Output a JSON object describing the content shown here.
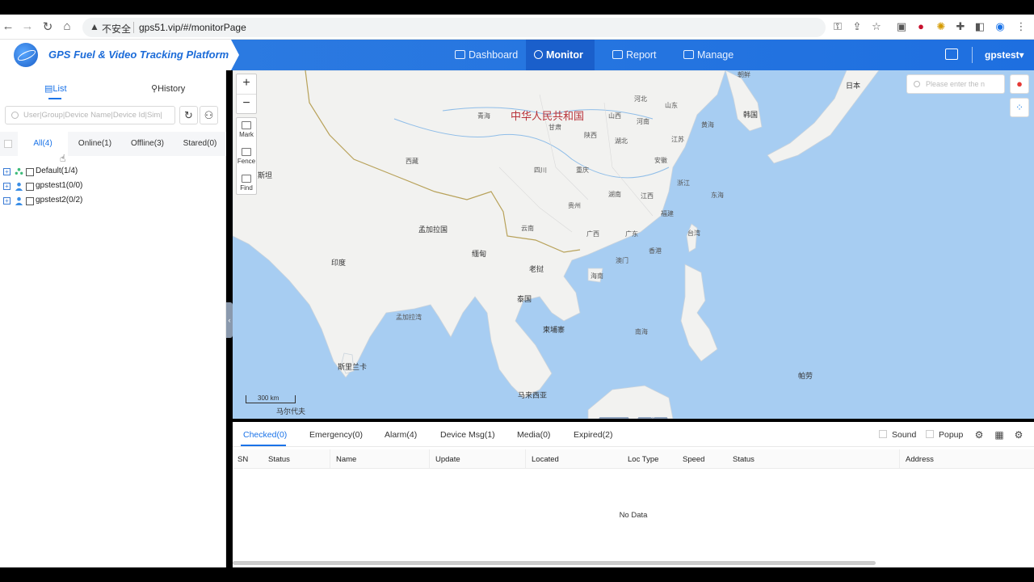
{
  "browser": {
    "insecure_label": "不安全",
    "url": "gps51.vip/#/monitorPage"
  },
  "app": {
    "title": "GPS Fuel & Video Tracking Platform",
    "menu": [
      {
        "label": "Dashboard",
        "active": false
      },
      {
        "label": "Monitor",
        "active": true
      },
      {
        "label": "Report",
        "active": false
      },
      {
        "label": "Manage",
        "active": false
      }
    ],
    "user": "gpstest▾"
  },
  "left": {
    "tabs": {
      "list": "List",
      "history": "History"
    },
    "search_placeholder": "User|Group|Device Name|Device Id|Sim|",
    "filters": [
      "All(4)",
      "Online(1)",
      "Offline(3)",
      "Stared(0)"
    ],
    "tree": [
      {
        "label": "Default(1/4)",
        "icon": "group-icon"
      },
      {
        "label": "gpstest1(0/0)",
        "icon": "user-icon"
      },
      {
        "label": "gpstest2(0/2)",
        "icon": "user-icon"
      }
    ]
  },
  "map": {
    "search_placeholder": "Please enter the n",
    "tools": {
      "mark": "Mark",
      "fence": "Fence",
      "find": "Find"
    },
    "scale": "300 km",
    "labels": {
      "china": "中华人民共和国",
      "japan": "日本",
      "korea": "韩国",
      "india": "印度",
      "bangladesh": "孟加拉国",
      "myanmar": "缅甸",
      "laos": "老挝",
      "thailand": "泰国",
      "cambodia": "柬埔寨",
      "srilanka": "斯里兰卡",
      "malaysia": "马来西亚",
      "maldives": "马尔代夫",
      "palau": "帕劳",
      "pakistan": "斯坦",
      "bay_bengal": "孟加拉湾",
      "south_sea": "南海",
      "east_sea": "东海",
      "yellow_sea": "黄海",
      "tibet": "西藏",
      "qinghai": "青海",
      "gansu": "甘肃",
      "sichuan": "四川",
      "yunnan": "云南",
      "guizhou": "贵州",
      "guangxi": "广西",
      "guangdong": "广东",
      "hainan": "海南",
      "hunan": "湖南",
      "hubei": "湖北",
      "jiangxi": "江西",
      "fujian": "福建",
      "zhejiang": "浙江",
      "anhui": "安徽",
      "jiangsu": "江苏",
      "henan": "河南",
      "shandong": "山东",
      "shanxi": "山西",
      "shaanxi": "陕西",
      "chongqing": "重庆",
      "taiwan": "台湾",
      "hongkong": "香港",
      "macau": "澳门",
      "hebei": "河北",
      "korea_north": "朝鲜"
    }
  },
  "bottom": {
    "tabs": [
      "Checked(0)",
      "Emergency(0)",
      "Alarm(4)",
      "Device Msg(1)",
      "Media(0)",
      "Expired(2)"
    ],
    "options": {
      "sound": "Sound",
      "popup": "Popup"
    },
    "columns": [
      "SN",
      "Status",
      "Name",
      "Update",
      "Located",
      "Loc Type",
      "Speed",
      "Status",
      "Address"
    ],
    "empty": "No Data"
  },
  "colors": {
    "accent": "#1a73e8",
    "header": "#2f7de1",
    "sea": "#a7cdf2",
    "land": "#f2f2f0"
  }
}
